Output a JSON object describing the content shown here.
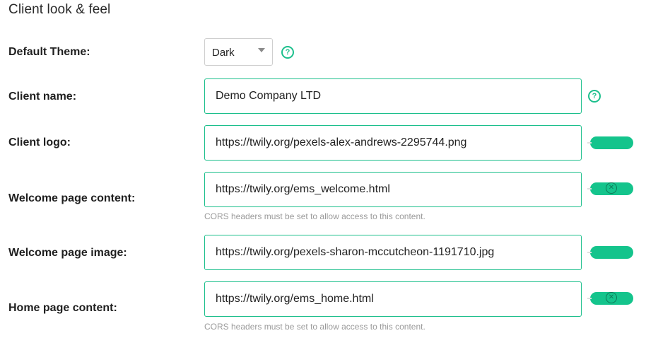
{
  "section": {
    "title": "Client look & feel"
  },
  "fields": {
    "default_theme": {
      "label": "Default Theme:",
      "value": "Dark",
      "help_glyph": "?"
    },
    "client_name": {
      "label": "Client name:",
      "value": "Demo Company LTD",
      "help_glyph": "?"
    },
    "client_logo": {
      "label": "Client logo:",
      "value": "https://twily.org/pexels-alex-andrews-2295744.png"
    },
    "welcome_content": {
      "label": "Welcome page content:",
      "value": "https://twily.org/ems_welcome.html",
      "hint": "CORS headers must be set to allow access to this content.",
      "clear_glyph": "✕"
    },
    "welcome_image": {
      "label": "Welcome page image:",
      "value": "https://twily.org/pexels-sharon-mccutcheon-1191710.jpg"
    },
    "home_content": {
      "label": "Home page content:",
      "value": "https://twily.org/ems_home.html",
      "hint": "CORS headers must be set to allow access to this content.",
      "clear_glyph": "✕"
    }
  },
  "colors": {
    "accent": "#1cbf8c",
    "toggle": "#14c48c",
    "hint": "#9a9a9a"
  },
  "icons": {
    "help": "help-circle-icon",
    "clear": "clear-circle-icon"
  }
}
